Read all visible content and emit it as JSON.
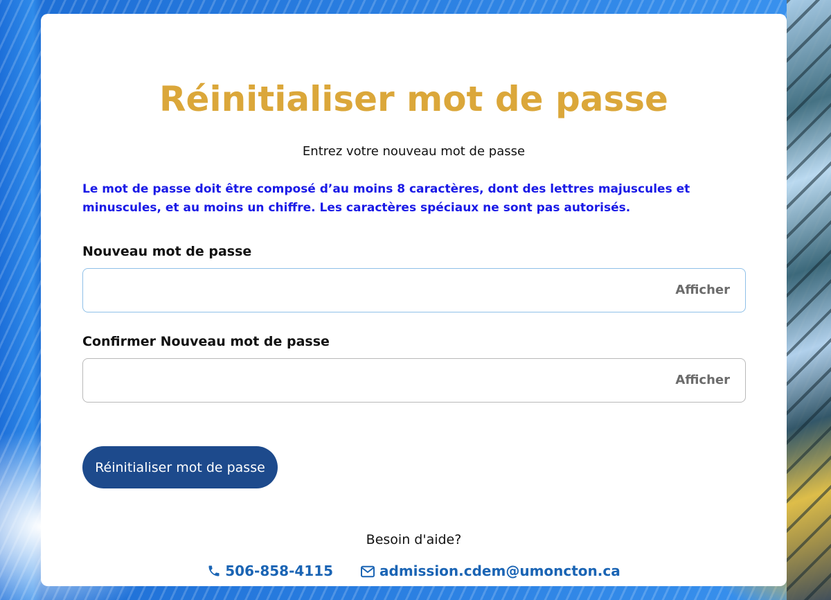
{
  "page": {
    "title": "Réinitialiser mot de passe",
    "subtitle": "Entrez votre nouveau mot de passe",
    "rule_text": "Le mot de passe doit être composé d’au moins 8 caractères, dont des lettres majuscules et minuscules, et au moins un chiffre. Les caractères spéciaux ne sont pas autorisés."
  },
  "form": {
    "new_password_label": "Nouveau mot de passe",
    "new_password_value": "",
    "confirm_password_label": "Confirmer Nouveau mot de passe",
    "confirm_password_value": "",
    "show_label": "Afficher",
    "submit_label": "Réinitialiser mot de passe"
  },
  "help": {
    "heading": "Besoin d'aide?",
    "phone": "506-858-4115",
    "email": "admission.cdem@umoncton.ca",
    "phone_icon": "phone-icon",
    "email_icon": "envelope-icon"
  },
  "colors": {
    "title": "#dba73a",
    "rule_text": "#1a1ae6",
    "button": "#1d4a8c",
    "link": "#1a64b4"
  }
}
